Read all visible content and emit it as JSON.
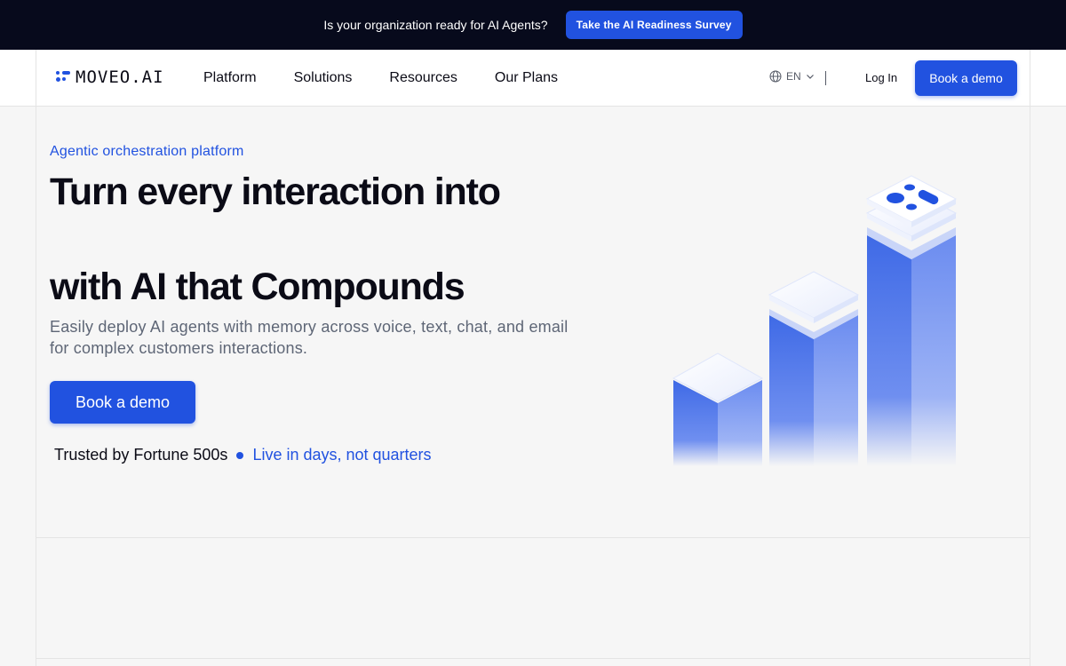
{
  "announcement": {
    "text": "Is your organization ready for AI Agents?",
    "button": "Take the AI Readiness Survey"
  },
  "nav": {
    "logo": "MOVEO.AI",
    "links": [
      "Platform",
      "Solutions",
      "Resources",
      "Our Plans"
    ],
    "language": "EN",
    "login": "Log In",
    "cta": "Book a demo"
  },
  "hero": {
    "eyebrow": "Agentic orchestration platform",
    "headline_line1": "Turn every interaction into",
    "headline_line2": "with AI that Compounds",
    "subtext": "Easily deploy AI agents with memory across voice, text, chat, and email for complex customers interactions.",
    "cta": "Book a demo",
    "trust_primary": "Trusted by Fortune 500s",
    "trust_secondary": "Live in days, not quarters"
  },
  "colors": {
    "brand_blue": "#2152e0",
    "announcement_bg": "#070a1c",
    "page_bg": "#f6f6f6"
  }
}
